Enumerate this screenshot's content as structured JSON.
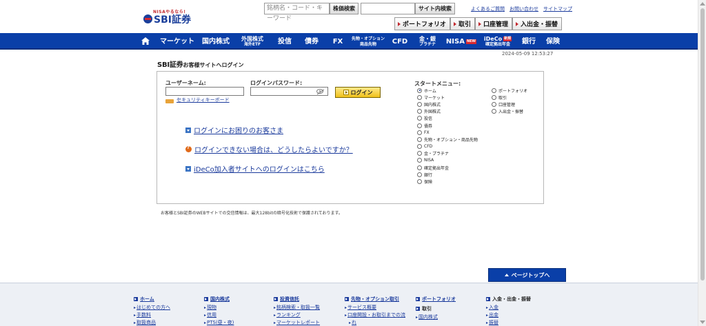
{
  "header": {
    "logo_tag": "NISAやるなら!",
    "logo_name": "SBI証券",
    "stock_search_placeholder": "銘柄名・コード・キーワード",
    "stock_search_button": "株価検索",
    "site_search_placeholder": "",
    "site_search_button": "サイト内検索",
    "util_links": [
      "よくあるご質問",
      "お問い合わせ",
      "サイトマップ"
    ],
    "quick_nav": [
      "ポートフォリオ",
      "取引",
      "口座管理",
      "入出金・振替"
    ]
  },
  "main_nav": {
    "items": [
      {
        "label": "マーケット"
      },
      {
        "label": "国内株式"
      },
      {
        "label": "外国株式",
        "sub": "海外ETF"
      },
      {
        "label": "投信"
      },
      {
        "label": "債券"
      },
      {
        "label": "FX"
      },
      {
        "label": "先物・オプション",
        "sub": "商品先物"
      },
      {
        "label": "CFD"
      },
      {
        "label": "金・銀",
        "sub": "プラチナ"
      },
      {
        "label": "NISA",
        "badge": "NEW"
      },
      {
        "label": "iDeCo",
        "sub": "確定拠出年金",
        "badge": "新規"
      },
      {
        "label": "銀行"
      },
      {
        "label": "保険"
      }
    ]
  },
  "timestamp": "2024-05-09 12:53:27",
  "login": {
    "title_brand": "SBI証券",
    "title_text": "お客様サイトへログイン",
    "username_label": "ユーザーネーム:",
    "username_value": "",
    "password_label": "ログインパスワード:",
    "password_value": "",
    "login_button": "ログイン",
    "security_keyboard": "セキュリティキーボード",
    "help_links": [
      "ログインにお困りのお客さま",
      "ログインできない場合は、どうしたらよいですか？",
      "iDeCo加入者サイトへのログインはこちら"
    ],
    "start_menu_title": "スタートメニュー:",
    "start_menu_left": [
      "ホーム",
      "マーケット",
      "国内株式",
      "外国株式",
      "投信",
      "債券",
      "FX",
      "先物・オプション・商品先物",
      "CFD",
      "金・プラチナ",
      "NISA",
      "確定拠出年金",
      "銀行",
      "保険"
    ],
    "start_menu_right": [
      "ポートフォリオ",
      "取引",
      "口座管理",
      "入出金・振替"
    ],
    "start_menu_selected": "ホーム"
  },
  "ssl_note": "お客様とSBI証券のWEBサイトでの交信情報は、最大128bitの暗号化技術で保護されております。",
  "page_top_button": "ページトップへ",
  "footer": {
    "columns": [
      {
        "head": "ホーム",
        "items": [
          "はじめての方へ",
          "手数料",
          "取扱商品"
        ]
      },
      {
        "head": "国内株式",
        "items": [
          "現物",
          "信用",
          "PTS(昼・夜)"
        ]
      },
      {
        "head": "投資信託",
        "items": [
          "銘柄検索・取扱一覧",
          "ランキング",
          "マーケットレポート"
        ]
      },
      {
        "head": "先物・オプション取引",
        "items": [
          "サービス概要",
          "口座開設・お取引までの流",
          "れ"
        ]
      },
      {
        "head": "ポートフォリオ",
        "head2": "取引",
        "items": [
          "国内株式"
        ]
      },
      {
        "head": "入金・出金・振替",
        "items": [
          "入金",
          "出金",
          "振替"
        ]
      }
    ]
  }
}
